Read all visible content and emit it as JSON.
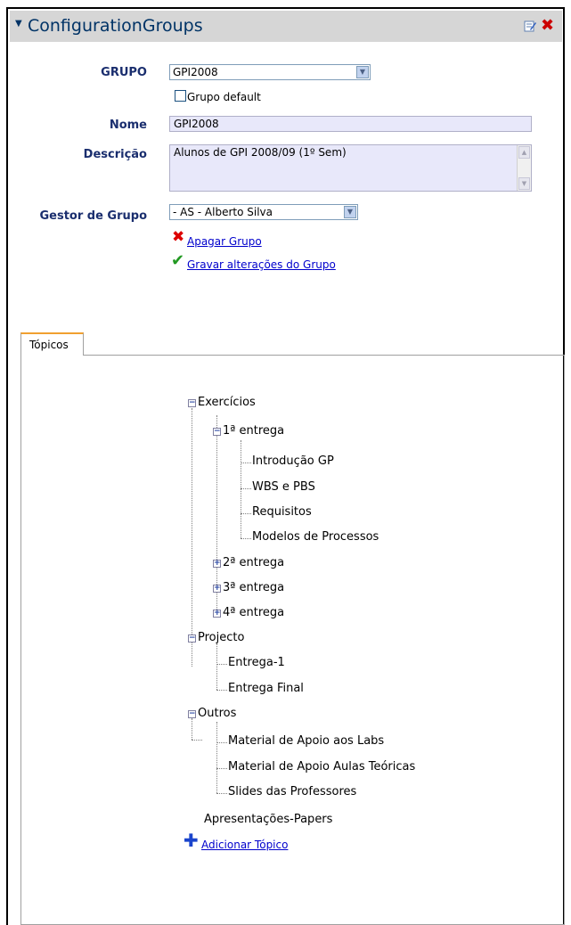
{
  "panel": {
    "title": "ConfigurationGroups"
  },
  "form": {
    "grupo_label": "GRUPO",
    "grupo_value": "GPI2008",
    "default_label": "Grupo default",
    "nome_label": "Nome",
    "nome_value": "GPI2008",
    "descricao_label": "Descrição",
    "descricao_value": "Alunos de GPI 2008/09 (1º Sem)",
    "gestor_label": "Gestor de Grupo",
    "gestor_value": "- AS - Alberto Silva",
    "delete_link": "Apagar Grupo",
    "save_link": "Gravar alterações do Grupo"
  },
  "tabs": {
    "topicos": "Tópicos"
  },
  "tree": {
    "exercicios": "Exercícios",
    "entrega1": "1ª entrega",
    "introducao": "Introdução GP",
    "wbs": "WBS e PBS",
    "requisitos": "Requisitos",
    "modelos": "Modelos de Processos",
    "entrega2": "2ª entrega",
    "entrega3": "3ª entrega",
    "entrega4": "4ª entrega",
    "projecto": "Projecto",
    "entrega_1": "Entrega-1",
    "entrega_final": "Entrega Final",
    "outros": "Outros",
    "material_labs": "Material de Apoio aos Labs",
    "material_teoricas": "Material de Apoio Aulas Teóricas",
    "slides": "Slides das Professores",
    "apresentacoes": "Apresentações-Papers",
    "add_topic": "Adicionar Tópico"
  },
  "icons": {
    "collapse": "−",
    "expand": "+",
    "delete": "✖",
    "save": "✔",
    "add": "✚",
    "dropdown": "▼",
    "caret": "▼",
    "scroll_up": "▲",
    "scroll_down": "▼"
  }
}
